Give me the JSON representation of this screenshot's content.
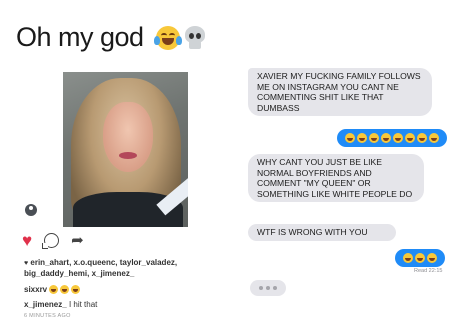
{
  "title": {
    "text": "Oh my god",
    "emojis": [
      "tears-of-joy-emoji",
      "skull-emoji"
    ]
  },
  "post": {
    "image_label": "selfie photo",
    "actions": [
      "heart-icon",
      "comment-icon",
      "share-icon"
    ],
    "likes_text": "erin_ahart, x.o.queenc, taylor_valadez, big_daddy_hemi, x_jimenez_",
    "comment1": {
      "user": "sixxrv"
    },
    "comment2": {
      "user": "x_jimenez_",
      "text": "I hit that"
    },
    "timestamp": "6 MINUTES AGO"
  },
  "messages": [
    {
      "side": "received",
      "text": "XAVIER MY FUCKING FAMILY FOLLOWS ME ON INSTAGRAM YOU CANT NE COMMENTING SHIT LIKE THAT DUMBASS"
    },
    {
      "side": "sent",
      "emoji_count": 8
    },
    {
      "side": "received",
      "text": "WHY CANT YOU JUST BE LIKE NORMAL BOYFRIENDS AND COMMENT \"MY QUEEN\" OR SOMETHING LIKE WHITE PEOPLE DO"
    },
    {
      "side": "received",
      "text": "WTF IS WRONG WITH YOU"
    },
    {
      "side": "sent",
      "emoji_count": 3
    }
  ],
  "read_receipt": "Read 22:15",
  "colors": {
    "sent_bubble": "#1f8bf7",
    "received_bubble": "#e5e5ea",
    "heart": "#e0314b"
  }
}
